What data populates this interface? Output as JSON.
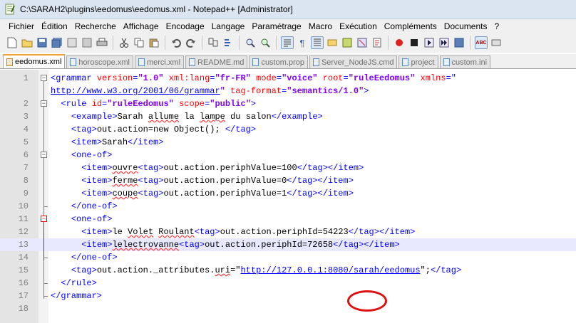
{
  "window": {
    "title": "C:\\SARAH2\\plugins\\eedomus\\eedomus.xml - Notepad++ [Administrator]"
  },
  "menu": [
    "Fichier",
    "Édition",
    "Recherche",
    "Affichage",
    "Encodage",
    "Langage",
    "Paramétrage",
    "Macro",
    "Exécution",
    "Compléments",
    "Documents",
    "?"
  ],
  "tabs": [
    {
      "label": "eedomus.xml",
      "active": true
    },
    {
      "label": "horoscope.xml",
      "active": false
    },
    {
      "label": "merci.xml",
      "active": false
    },
    {
      "label": "README.md",
      "active": false
    },
    {
      "label": "custom.prop",
      "active": false
    },
    {
      "label": "Server_NodeJS.cmd",
      "active": false
    },
    {
      "label": "project",
      "active": false
    },
    {
      "label": "custom.ini",
      "active": false
    }
  ],
  "editor": {
    "current_line": 13,
    "highlighted_value": "54223",
    "lines": [
      {
        "n": "1",
        "segs": [
          [
            "tag",
            "<grammar "
          ],
          [
            "attr",
            "version"
          ],
          [
            "tag",
            "="
          ],
          [
            "val",
            "\"1.0\" "
          ],
          [
            "attr",
            "xml:lang"
          ],
          [
            "tag",
            "="
          ],
          [
            "val",
            "\"fr-FR\" "
          ],
          [
            "attr",
            "mode"
          ],
          [
            "tag",
            "="
          ],
          [
            "val",
            "\"voice\" "
          ],
          [
            "attr",
            "root"
          ],
          [
            "tag",
            "="
          ],
          [
            "val",
            "\"ruleEedomus\" "
          ],
          [
            "attr",
            "xmlns"
          ],
          [
            "tag",
            "=\""
          ]
        ]
      },
      {
        "n": "",
        "segs": [
          [
            "url",
            "http://www.w3.org/2001/06/grammar"
          ],
          [
            "val",
            "\" "
          ],
          [
            "attr",
            "tag-format"
          ],
          [
            "tag",
            "="
          ],
          [
            "val",
            "\"semantics/1.0\""
          ],
          [
            "tag",
            ">"
          ]
        ]
      },
      {
        "n": "2",
        "segs": [
          [
            "text",
            "  "
          ],
          [
            "tag",
            "<rule "
          ],
          [
            "attr",
            "id"
          ],
          [
            "tag",
            "="
          ],
          [
            "val",
            "\"ruleEedomus\" "
          ],
          [
            "attr",
            "scope"
          ],
          [
            "tag",
            "="
          ],
          [
            "val",
            "\"public\""
          ],
          [
            "tag",
            ">"
          ]
        ]
      },
      {
        "n": "3",
        "segs": [
          [
            "text",
            "    "
          ],
          [
            "tag",
            "<example>"
          ],
          [
            "text",
            "Sarah "
          ],
          [
            "sq",
            "allume"
          ],
          [
            "text",
            " la "
          ],
          [
            "sq",
            "lampe"
          ],
          [
            "text",
            " du salon"
          ],
          [
            "tag",
            "</example>"
          ]
        ]
      },
      {
        "n": "4",
        "segs": [
          [
            "text",
            "    "
          ],
          [
            "tag",
            "<tag>"
          ],
          [
            "text",
            "out.action=new Object(); "
          ],
          [
            "tag",
            "</tag>"
          ]
        ]
      },
      {
        "n": "5",
        "segs": [
          [
            "text",
            "    "
          ],
          [
            "tag",
            "<item>"
          ],
          [
            "text",
            "Sarah"
          ],
          [
            "tag",
            "</item>"
          ]
        ]
      },
      {
        "n": "6",
        "segs": [
          [
            "text",
            "    "
          ],
          [
            "tag",
            "<one-of>"
          ]
        ]
      },
      {
        "n": "7",
        "segs": [
          [
            "text",
            "      "
          ],
          [
            "tag",
            "<item>"
          ],
          [
            "sq",
            "ouvre"
          ],
          [
            "tag",
            "<tag>"
          ],
          [
            "text",
            "out.action.periphValue=100"
          ],
          [
            "tag",
            "</tag></item>"
          ]
        ]
      },
      {
        "n": "8",
        "segs": [
          [
            "text",
            "      "
          ],
          [
            "tag",
            "<item>"
          ],
          [
            "sq",
            "ferme"
          ],
          [
            "tag",
            "<tag>"
          ],
          [
            "text",
            "out.action.periphValue=0"
          ],
          [
            "tag",
            "</tag></item>"
          ]
        ]
      },
      {
        "n": "9",
        "segs": [
          [
            "text",
            "      "
          ],
          [
            "tag",
            "<item>"
          ],
          [
            "sq",
            "coupe"
          ],
          [
            "tag",
            "<tag>"
          ],
          [
            "text",
            "out.action.periphValue=1"
          ],
          [
            "tag",
            "</tag></item>"
          ]
        ]
      },
      {
        "n": "10",
        "segs": [
          [
            "text",
            "    "
          ],
          [
            "tag",
            "</one-of>"
          ]
        ]
      },
      {
        "n": "11",
        "segs": [
          [
            "text",
            "    "
          ],
          [
            "tag",
            "<one-of>"
          ]
        ]
      },
      {
        "n": "12",
        "segs": [
          [
            "text",
            "      "
          ],
          [
            "tag",
            "<item>"
          ],
          [
            "text",
            "le "
          ],
          [
            "sq",
            "Volet"
          ],
          [
            "text",
            " "
          ],
          [
            "sq",
            "Roulant"
          ],
          [
            "tag",
            "<tag>"
          ],
          [
            "text",
            "out.action.periphId=54223"
          ],
          [
            "tag",
            "</tag></item>"
          ]
        ]
      },
      {
        "n": "13",
        "segs": [
          [
            "text",
            "      "
          ],
          [
            "tag",
            "<item>"
          ],
          [
            "sq",
            "lelectrovanne"
          ],
          [
            "tag",
            "<tag>"
          ],
          [
            "text",
            "out.action.periphId=72658"
          ],
          [
            "tag",
            "</tag></item>"
          ]
        ]
      },
      {
        "n": "14",
        "segs": [
          [
            "text",
            "    "
          ],
          [
            "tag",
            "</one-of>"
          ]
        ]
      },
      {
        "n": "15",
        "segs": [
          [
            "text",
            "    "
          ],
          [
            "tag",
            "<tag>"
          ],
          [
            "text",
            "out.action._attributes."
          ],
          [
            "sq",
            "uri"
          ],
          [
            "text",
            "=\""
          ],
          [
            "url",
            "http://127.0.0.1:8080/sarah/eedomus"
          ],
          [
            "text",
            "\";"
          ],
          [
            "tag",
            "</tag>"
          ]
        ]
      },
      {
        "n": "16",
        "segs": [
          [
            "text",
            "  "
          ],
          [
            "tag",
            "</rule>"
          ]
        ]
      },
      {
        "n": "17",
        "segs": [
          [
            "tag",
            "</grammar>"
          ]
        ]
      },
      {
        "n": "18",
        "segs": []
      }
    ]
  }
}
